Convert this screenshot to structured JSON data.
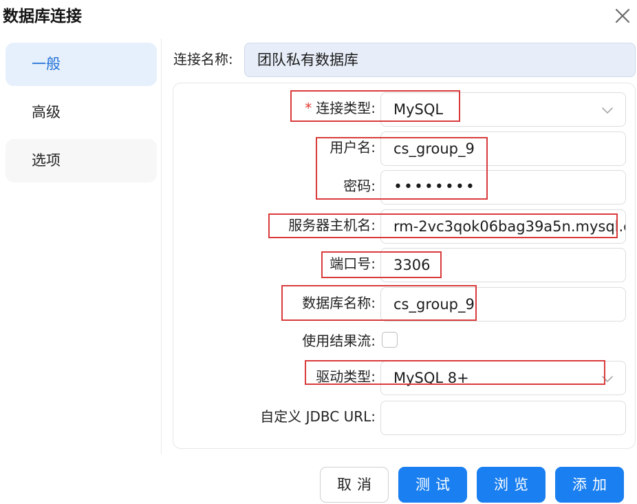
{
  "dialog": {
    "title": "数据库连接"
  },
  "icons": {
    "close": "close-icon",
    "chevron": "chevron-down-icon"
  },
  "colors": {
    "accent": "#1a7ff0",
    "active_nav_bg": "#e6f0fc",
    "highlight": "#d93a3a",
    "required": "#e0392f"
  },
  "nav": {
    "items": [
      {
        "label": "一般",
        "active": true
      },
      {
        "label": "高级",
        "active": false
      },
      {
        "label": "选项",
        "active": false
      }
    ]
  },
  "connection": {
    "label": "连接名称:",
    "value": "团队私有数据库"
  },
  "form": {
    "required_mark": "*",
    "type": {
      "label": "连接类型:",
      "value": "MySQL"
    },
    "username": {
      "label": "用户名:",
      "value": "cs_group_9"
    },
    "password": {
      "label": "密码:",
      "value": "••••••••"
    },
    "host": {
      "label": "服务器主机名:",
      "value": "rm-2vc3qok06bag39a5n.mysql.c"
    },
    "port": {
      "label": "端口号:",
      "value": "3306"
    },
    "database": {
      "label": "数据库名称:",
      "value": "cs_group_9"
    },
    "stream": {
      "label": "使用结果流:",
      "checked": false
    },
    "driver": {
      "label": "驱动类型:",
      "value": "MySQL 8+"
    },
    "jdbc": {
      "label": "自定义 JDBC URL:",
      "value": ""
    }
  },
  "buttons": {
    "cancel": "取消",
    "test": "测试",
    "browse": "浏览",
    "add": "添加"
  }
}
